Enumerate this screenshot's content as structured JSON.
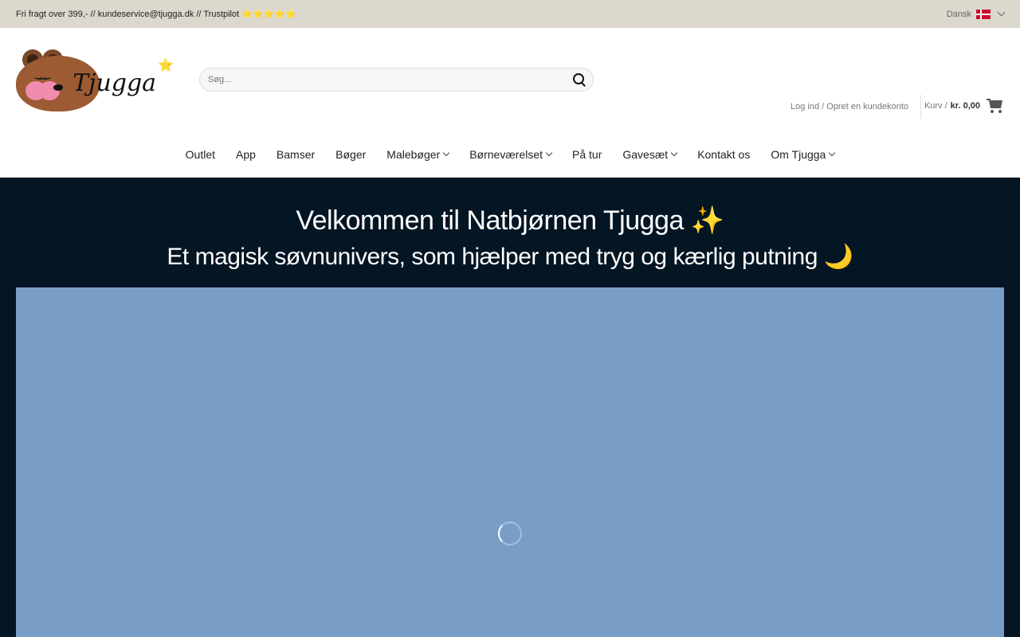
{
  "topbar": {
    "info_text": "Fri fragt over 399,- // kundeservice@tjugga.dk // Trustpilot ⭐⭐⭐⭐⭐",
    "language": "Dansk"
  },
  "logo": {
    "text": "Tjugga",
    "star": "⭐"
  },
  "search": {
    "placeholder": "Søg..."
  },
  "account": {
    "label": "Log ind / Opret en kundekonto"
  },
  "cart": {
    "label": "Kurv /",
    "amount": "kr. 0,00"
  },
  "nav": {
    "items": [
      {
        "label": "Outlet"
      },
      {
        "label": "App"
      },
      {
        "label": "Bamser"
      },
      {
        "label": "Bøger"
      },
      {
        "label": "Malebøger"
      },
      {
        "label": "Børneværelset"
      },
      {
        "label": "På tur"
      },
      {
        "label": "Gavesæt"
      },
      {
        "label": "Kontakt os"
      },
      {
        "label": "Om Tjugga"
      }
    ]
  },
  "hero": {
    "title": "Velkommen til Natbjørnen Tjugga ✨",
    "subtitle": "Et magisk søvnunivers, som hjælper med tryg og kærlig putning 🌙"
  },
  "colors": {
    "topbar_bg": "#ddd8cd",
    "hero_bg": "#041523",
    "video_bg": "#789dc7"
  }
}
